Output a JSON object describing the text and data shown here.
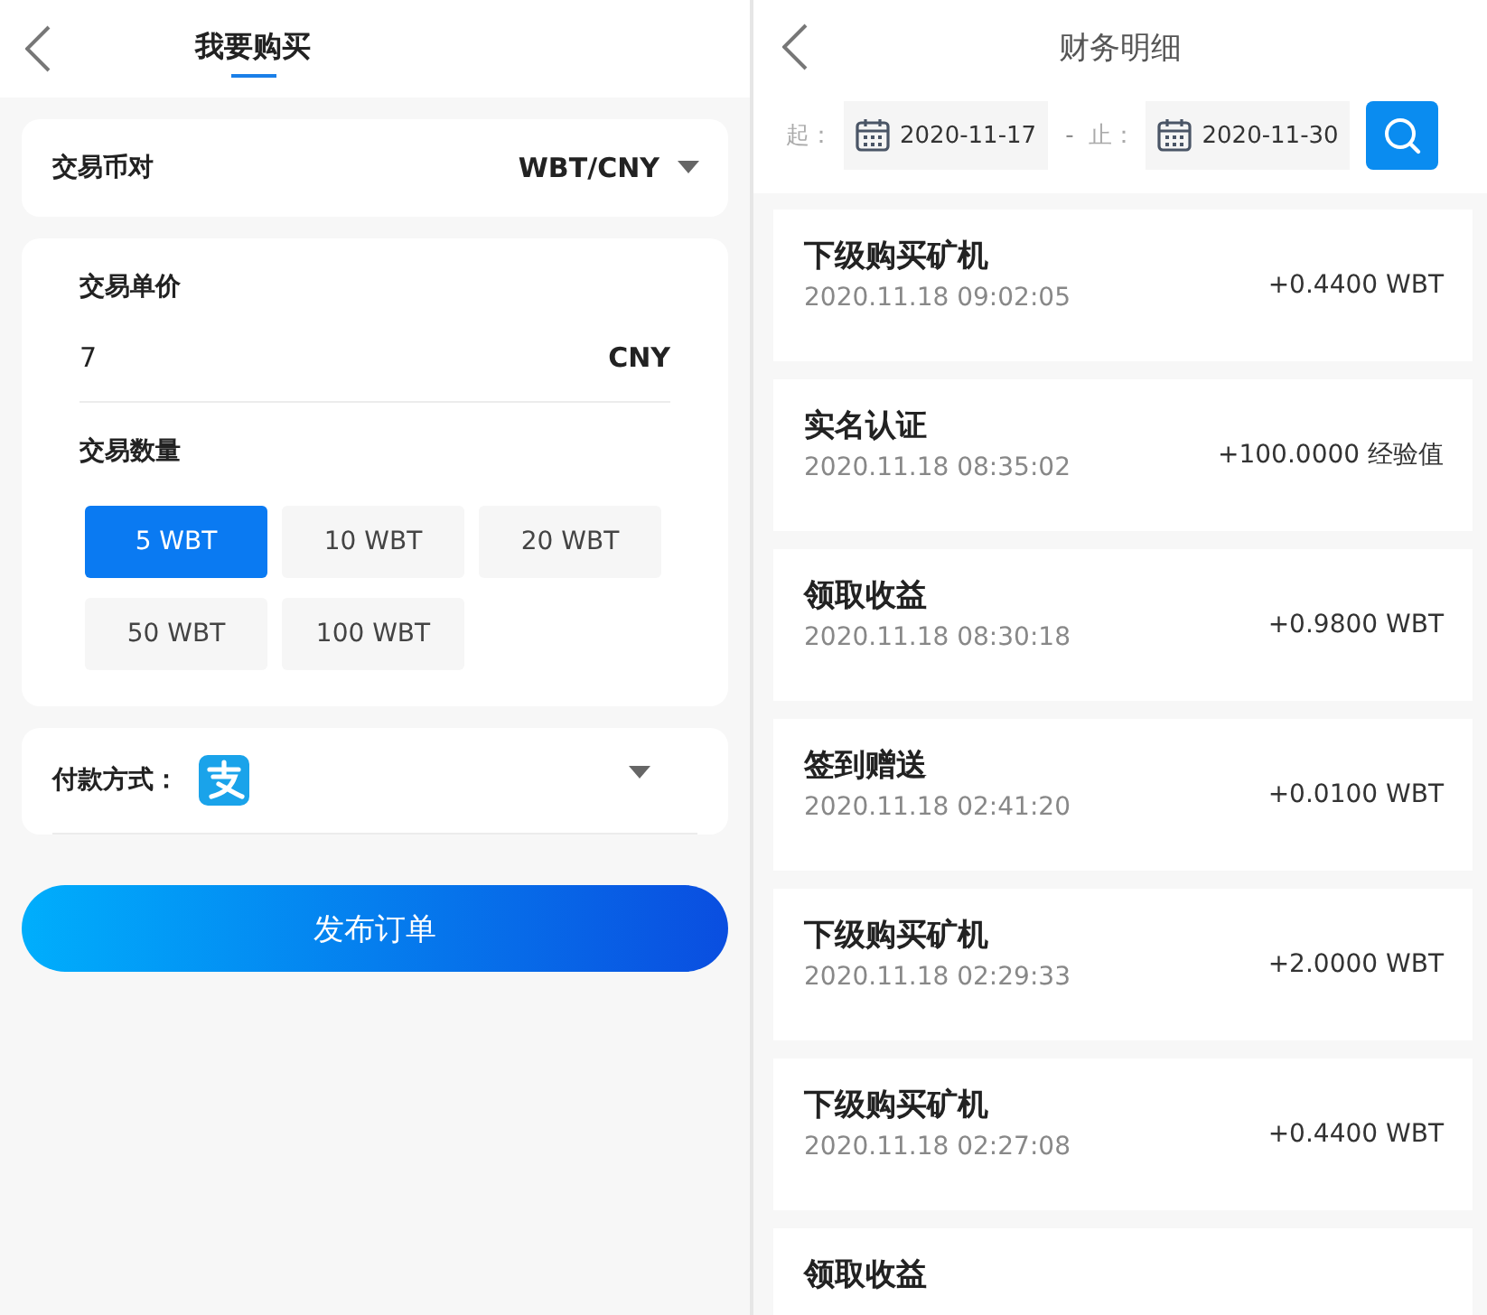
{
  "buy_panel": {
    "title": "我要购买",
    "pair": {
      "label": "交易币对",
      "value": "WBT/CNY"
    },
    "price": {
      "label": "交易单价",
      "value": "7",
      "unit": "CNY"
    },
    "quantity": {
      "label": "交易数量",
      "options": [
        {
          "label": "5 WBT",
          "selected": true
        },
        {
          "label": "10 WBT",
          "selected": false
        },
        {
          "label": "20 WBT",
          "selected": false
        },
        {
          "label": "50 WBT",
          "selected": false
        },
        {
          "label": "100 WBT",
          "selected": false
        }
      ]
    },
    "payment": {
      "label": "付款方式："
    },
    "submit_button": "发布订单"
  },
  "finance_panel": {
    "title": "财务明细",
    "filter": {
      "start_label": "起：",
      "start_date": "2020-11-17",
      "separator": "-",
      "end_label": "止：",
      "end_date": "2020-11-30"
    },
    "records": [
      {
        "title": "下级购买矿机",
        "time": "2020.11.18 09:02:05",
        "amount": "+0.4400 WBT"
      },
      {
        "title": "实名认证",
        "time": "2020.11.18 08:35:02",
        "amount": "+100.0000 经验值"
      },
      {
        "title": "领取收益",
        "time": "2020.11.18 08:30:18",
        "amount": "+0.9800 WBT"
      },
      {
        "title": "签到赠送",
        "time": "2020.11.18 02:41:20",
        "amount": "+0.0100 WBT"
      },
      {
        "title": "下级购买矿机",
        "time": "2020.11.18 02:29:33",
        "amount": "+2.0000 WBT"
      },
      {
        "title": "下级购买矿机",
        "time": "2020.11.18 02:27:08",
        "amount": "+0.4400 WBT"
      },
      {
        "title": "领取收益"
      }
    ]
  }
}
